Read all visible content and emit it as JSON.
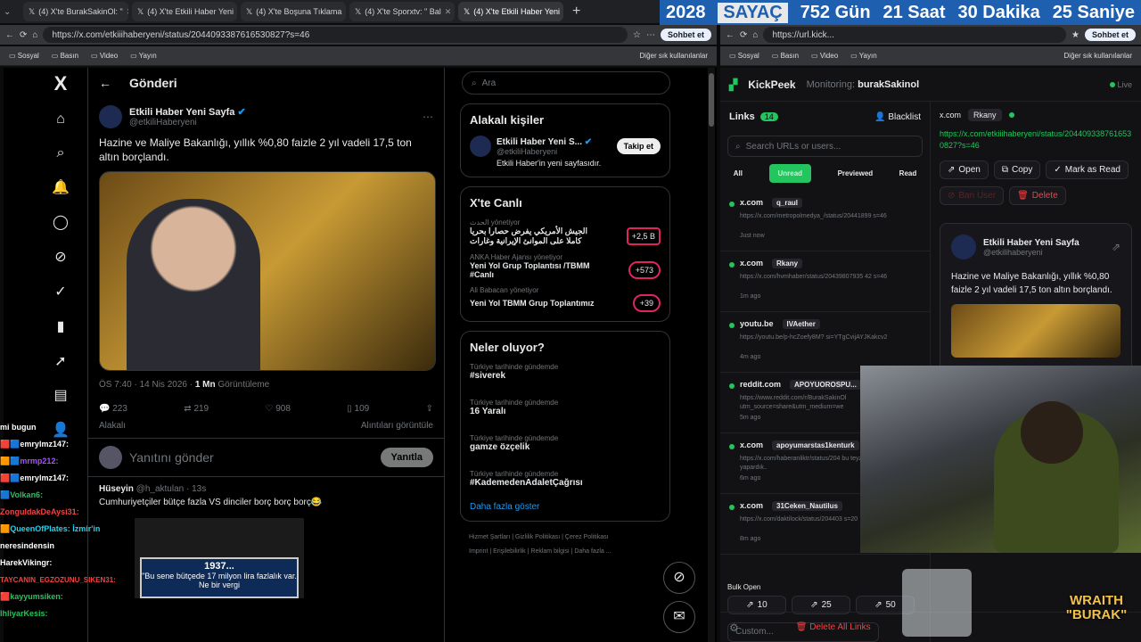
{
  "tabs": [
    "(4) X'te BurakSakinOl: \"",
    "(4) X'te Etkili Haber Yeni",
    "(4) X'te Boşuna Tıklama",
    "(4) X'te Sporxtv: \" Bal",
    "(4) X'te Etkili Haber Yeni"
  ],
  "counter": {
    "year": "2028",
    "label": "SAYAÇ",
    "days": "752 Gün",
    "hours": "21 Saat",
    "minutes": "30 Dakika",
    "seconds": "25 Saniye"
  },
  "left_url": "https://x.com/etkiiihaberyeni/status/2044093387616530827?s=46",
  "right_url": "https://url.kick...",
  "chip": "Sohbet et",
  "bookmarks": [
    "Sosyal",
    "Basın",
    "Video",
    "Yayın"
  ],
  "bookmarks_other": "Diğer sık kullanılanlar",
  "x": {
    "logo": "X",
    "header_title": "Gönderi",
    "post": {
      "author": "Etkili Haber Yeni Sayfa",
      "handle": "@etkiliHaberyeni",
      "text": "Hazine ve Maliye Bakanlığı, yıllık %0,80 faizle 2 yıl vadeli 17,5 ton altın borçlandı.",
      "time": "ÖS 7:40 · 14 Nis 2026 ·",
      "views": "1 Mn",
      "views_label": "Görüntüleme",
      "replies": "223",
      "retweets": "219",
      "likes": "908",
      "bookmarks": "109"
    },
    "related_label": "Alakalı",
    "quotes_label": "Alıntıları görüntüle",
    "reply_placeholder": "Yanıtını gönder",
    "reply_button": "Yanıtla",
    "reply": {
      "author": "Hüseyin",
      "handle": "@h_aktulan · 13s",
      "text": "Cumhuriyetçiler bütçe fazla VS dinciler borç borç borç😂",
      "quote_year": "1937...",
      "quote_text": "\"Bu sene bütçede 17 milyon lira fazlalık var. Ne bir vergi"
    },
    "search_placeholder": "Ara",
    "relevant": {
      "title": "Alakalı kişiler",
      "name": "Etkili Haber Yeni S...",
      "handle": "@etkiliHaberyeni",
      "bio": "Etkili Haber'in yeni sayfasıdır.",
      "follow": "Takip et"
    },
    "live": {
      "title": "X'te Canlı",
      "items": [
        {
          "source": "الحدث",
          "role": "yönetiyor",
          "text": "الجيش الأمريكي يفرض حصارا بحريا كاملا على الموانئ الإيرانية وغارات",
          "badge": "+2,5 B"
        },
        {
          "source": "ANKA Haber Ajansı",
          "role": "yönetiyor",
          "text": "Yeni Yol Grup Toplantısı /TBMM #Canlı",
          "badge": "+573"
        },
        {
          "source": "Ali Babacan",
          "role": "yönetiyor",
          "text": "Yeni Yol TBMM Grup Toplantımız",
          "badge": "+39"
        }
      ]
    },
    "trends": {
      "title": "Neler oluyor?",
      "items": [
        {
          "ctx": "Türkiye tarihinde gündemde",
          "name": "#siverek"
        },
        {
          "ctx": "Türkiye tarihinde gündemde",
          "name": "16 Yaralı"
        },
        {
          "ctx": "Türkiye tarihinde gündemde",
          "name": "gamze özçelik"
        },
        {
          "ctx": "Türkiye tarihinde gündemde",
          "name": "#KademedenAdaletÇağrısı"
        }
      ],
      "more": "Daha fazla göster"
    },
    "footer": [
      "Hizmet Şartları",
      "Gizlilik Politikası",
      "Çerez Politikası",
      "Imprint",
      "Erişilebilirlik",
      "Reklam bilgisi",
      "Daha fazla ..."
    ]
  },
  "kp": {
    "name": "KickPeek",
    "monitoring_label": "Monitoring:",
    "user": "burakSakinol",
    "status": "Live",
    "links_label": "Links",
    "links_count": "14",
    "blacklist": "Blacklist",
    "search_placeholder": "Search URLs or users...",
    "filters": [
      "All",
      "Unread",
      "Previewed",
      "Read"
    ],
    "links": [
      {
        "domain": "x.com",
        "user": "q_raul",
        "url": "https://x.com/metropolmedya_/status/20441899 s=46",
        "time": "Just now"
      },
      {
        "domain": "x.com",
        "user": "Rkany",
        "url": "https://x.com/hvmhaber/status/20439807935 42 s=46",
        "time": "1m ago"
      },
      {
        "domain": "youtu.be",
        "user": "IVAether",
        "url": "https://youtu.be/p-hcZoefy8M? si=YTgCvijAYJKakcv2",
        "time": "4m ago"
      },
      {
        "domain": "reddit.com",
        "user": "APOYUOROSPU...",
        "url": "https://www.reddit.com/r/BurakSakinOl utm_source=share&utm_medium=we",
        "time": "5m ago"
      },
      {
        "domain": "x.com",
        "user": "apoyumarstas1kenturk",
        "url": "https://x.com/haberanliktr/status/204 bu teyzeyi bize verseler ne yapardık..",
        "time": "6m ago"
      },
      {
        "domain": "x.com",
        "user": "31Ceken_Nautilus",
        "url": "https://x.com/daktilock/status/204403 s=20",
        "time": "8m ago"
      }
    ],
    "bulk_open": "Bulk Open",
    "bulk": [
      "10",
      "25",
      "50"
    ],
    "custom_placeholder": "Custom...",
    "delete_all": "Delete All Links",
    "detail": {
      "domain": "x.com",
      "user": "Rkany",
      "url": "https://x.com/etkiiihaberyeni/status/2044093387616530827?s=46",
      "open": "Open",
      "copy": "Copy",
      "mark": "Mark as Read",
      "ban": "Ban User",
      "delete": "Delete",
      "card_name": "Etkili Haber Yeni Sayfa",
      "card_handle": "@etkilihaberyeni",
      "card_text": "Hazine ve Maliye Bakanlığı, yıllık %0,80 faizle 2 yıl vadeli 17,5 ton altın borçlandı."
    }
  },
  "chat": [
    {
      "user": "mi bugun",
      "color": "#ffffff"
    },
    {
      "user": "emrylmz147:",
      "color": "#ffffff"
    },
    {
      "user": "mrmp212:",
      "color": "#a855f7"
    },
    {
      "user": "emrylmz147:",
      "color": "#ffffff"
    },
    {
      "user": "Volkan6:",
      "color": "#22c55e"
    },
    {
      "user": "ZonguldakDeAysi31:",
      "color": "#ef4444"
    },
    {
      "user": "QueenOfPlates: İzmir'in",
      "color": "#22d3ee"
    },
    {
      "user": "neresindensin",
      "color": "#ffffff"
    },
    {
      "user": "HarekVikingr:",
      "color": "#ffffff"
    },
    {
      "user": "TAYCANIN_EGZOZUNU_SIKEN31:",
      "color": "#ef4444"
    },
    {
      "user": "kayyumsiken:",
      "color": "#22c55e"
    },
    {
      "user": "IhliyarKesis:",
      "color": "#22c55e"
    }
  ],
  "brand": {
    "line1": "WRAITH",
    "line2": "\"BURAK\""
  }
}
